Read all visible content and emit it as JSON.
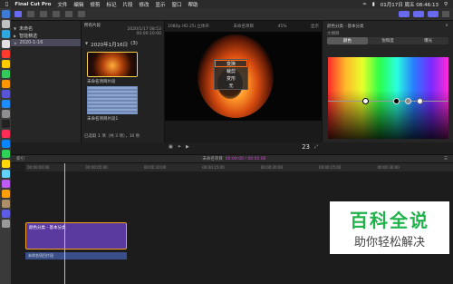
{
  "menubar": {
    "app": "Final Cut Pro",
    "items": [
      "文件",
      "编辑",
      "修剪",
      "标记",
      "片段",
      "修改",
      "显示",
      "窗口",
      "帮助"
    ],
    "clock": "01月17日 周五 08:46:13"
  },
  "sidebar": {
    "items": [
      {
        "label": "未命名"
      },
      {
        "label": "智能精选"
      },
      {
        "label": "2020-1-16"
      }
    ]
  },
  "browser": {
    "header": "所有片段",
    "meta_date": "2020/1/17 08:53",
    "meta_tc": "00:00:10:00",
    "date_header": "2020年1月16日",
    "date_count": "(3)",
    "clip1_label": "未命名项目片段",
    "clip2_label": "未命名项目片段1",
    "footer": "已选取 1 项（共 3 项），10 秒"
  },
  "viewer": {
    "format": "1080p HD 25i 立体声",
    "project": "未命名项目",
    "zoom": "45%",
    "view_label": "显示",
    "timecode": "23",
    "context_menu": [
      "变换",
      "裁剪",
      "变形",
      "无"
    ]
  },
  "inspector": {
    "title": "颜色分类 - 基本分类",
    "subtitle": "大纲目",
    "tabs": [
      "颜色",
      "饱和度",
      "曝光"
    ]
  },
  "timeline": {
    "index_label": "索引",
    "project": "未命名项目",
    "timecode": "00:00:00 / 00:01:00",
    "ruler": [
      "00:00:00:00",
      "00:00:05:00",
      "00:00:10:00",
      "00:00:15:00",
      "00:00:20:00",
      "00:00:25:00",
      "00:00:30:00",
      "00:00:35:00",
      "00:00:40:00",
      "00:00:45:00"
    ],
    "clip_label": "颜色分类 - 基本分类",
    "audio_label": "未命名项目片段"
  },
  "watermark": {
    "title": "百科全说",
    "subtitle": "助你轻松解决"
  },
  "colors": {
    "accent": "#6a6af0",
    "clip": "#5b3aa0",
    "selection": "#ffd04a",
    "highlight": "#ff6a1a",
    "watermark_green": "#20b24a"
  }
}
